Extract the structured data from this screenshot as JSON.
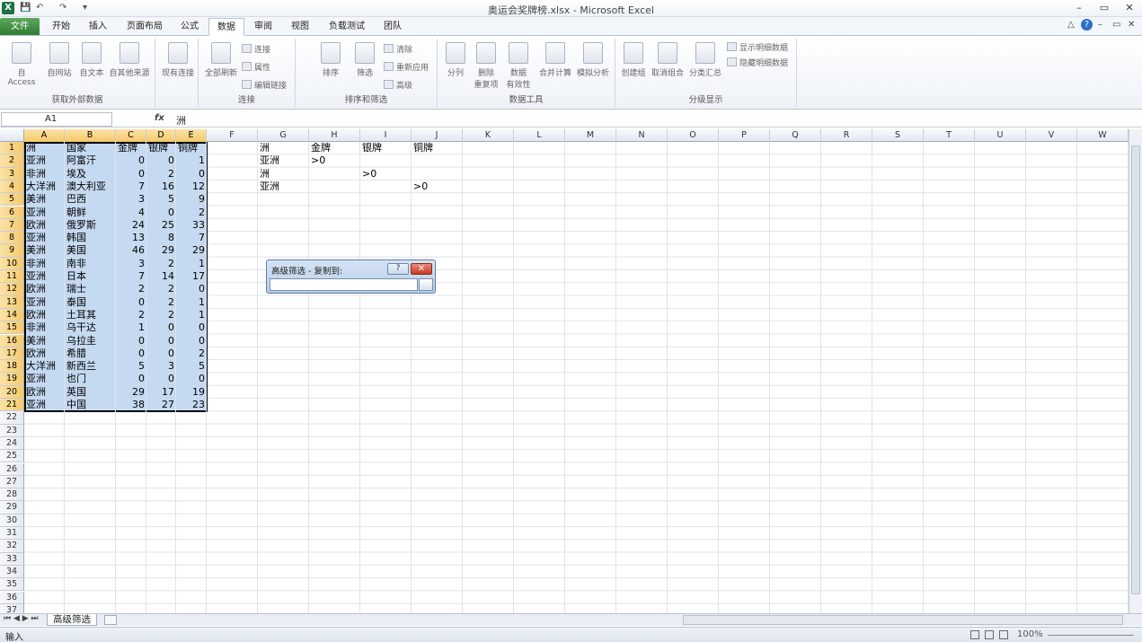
{
  "window": {
    "title": "奥运会奖牌榜.xlsx - Microsoft Excel",
    "app_icon": "X",
    "qat": [
      "💾",
      "↶",
      "↷",
      "▾"
    ],
    "controls": [
      "–",
      "▭",
      "✕"
    ],
    "app_controls": [
      "△",
      "?",
      "–",
      "▭",
      "✕"
    ]
  },
  "tabs": [
    "开始",
    "插入",
    "页面布局",
    "公式",
    "数据",
    "审阅",
    "视图",
    "负载测试",
    "团队"
  ],
  "file_tab": "文件",
  "ribbon": {
    "groups": [
      {
        "label": "获取外部数据",
        "buttons": [
          "自 Access",
          "自网站",
          "自文本",
          "自其他来源"
        ]
      },
      {
        "label": "",
        "buttons": [
          "现有连接"
        ]
      },
      {
        "label": "连接",
        "buttons": [
          "全部刷新"
        ],
        "small": [
          "连接",
          "属性",
          "编辑链接"
        ]
      },
      {
        "label": "排序和筛选",
        "buttons": [
          "排序",
          "筛选"
        ],
        "small": [
          "清除",
          "重新应用",
          "高级"
        ]
      },
      {
        "label": "数据工具",
        "buttons": [
          "分列",
          "删除\n重复项",
          "数据\n有效性",
          "合并计算",
          "模拟分析"
        ]
      },
      {
        "label": "分级显示",
        "buttons": [
          "创建组",
          "取消组合",
          "分类汇总"
        ],
        "small": [
          "显示明细数据",
          "隐藏明细数据"
        ]
      }
    ]
  },
  "formula": {
    "namebox": "A1",
    "fx": "fx",
    "value": "洲"
  },
  "columns": [
    "A",
    "B",
    "C",
    "D",
    "E",
    "F",
    "G",
    "H",
    "I",
    "J",
    "K",
    "L",
    "M",
    "N",
    "O",
    "P",
    "Q",
    "R",
    "S",
    "T",
    "U",
    "V",
    "W"
  ],
  "rows": [
    "1",
    "2",
    "3",
    "4",
    "5",
    "6",
    "7",
    "8",
    "9",
    "10",
    "11",
    "12",
    "13",
    "14",
    "15",
    "16",
    "17",
    "18",
    "19",
    "20",
    "21",
    "22",
    "23",
    "24",
    "25",
    "26",
    "27",
    "28",
    "29",
    "30",
    "31",
    "32",
    "33",
    "34",
    "35",
    "36",
    "37"
  ],
  "table": {
    "header": [
      "洲",
      "国家",
      "金牌",
      "银牌",
      "铜牌"
    ],
    "rows": [
      [
        "亚洲",
        "阿富汗",
        "0",
        "0",
        "1"
      ],
      [
        "非洲",
        "埃及",
        "0",
        "2",
        "0"
      ],
      [
        "大洋洲",
        "澳大利亚",
        "7",
        "16",
        "12"
      ],
      [
        "美洲",
        "巴西",
        "3",
        "5",
        "9"
      ],
      [
        "亚洲",
        "朝鲜",
        "4",
        "0",
        "2"
      ],
      [
        "欧洲",
        "俄罗斯",
        "24",
        "25",
        "33"
      ],
      [
        "亚洲",
        "韩国",
        "13",
        "8",
        "7"
      ],
      [
        "美洲",
        "美国",
        "46",
        "29",
        "29"
      ],
      [
        "非洲",
        "南非",
        "3",
        "2",
        "1"
      ],
      [
        "亚洲",
        "日本",
        "7",
        "14",
        "17"
      ],
      [
        "欧洲",
        "瑞士",
        "2",
        "2",
        "0"
      ],
      [
        "亚洲",
        "泰国",
        "0",
        "2",
        "1"
      ],
      [
        "欧洲",
        "土耳其",
        "2",
        "2",
        "1"
      ],
      [
        "非洲",
        "乌干达",
        "1",
        "0",
        "0"
      ],
      [
        "美洲",
        "乌拉圭",
        "0",
        "0",
        "0"
      ],
      [
        "欧洲",
        "希腊",
        "0",
        "0",
        "2"
      ],
      [
        "大洋洲",
        "新西兰",
        "5",
        "3",
        "5"
      ],
      [
        "亚洲",
        "也门",
        "0",
        "0",
        "0"
      ],
      [
        "欧洲",
        "英国",
        "29",
        "17",
        "19"
      ],
      [
        "亚洲",
        "中国",
        "38",
        "27",
        "23"
      ]
    ]
  },
  "criteria": {
    "header": [
      "洲",
      "金牌",
      "银牌",
      "铜牌"
    ],
    "rows": [
      [
        "亚洲",
        ">0",
        "",
        ""
      ],
      [
        "洲",
        "",
        ">0",
        ""
      ],
      [
        "亚洲",
        "",
        "",
        ">0"
      ]
    ]
  },
  "dialog": {
    "title": "高级筛选 - 复制到:",
    "help": "?",
    "close": "✕"
  },
  "sheet": {
    "tab": "高级筛选",
    "nav": "⏮ ◀ ▶ ⏭"
  },
  "status": {
    "mode": "输入",
    "zoom": "100%"
  }
}
